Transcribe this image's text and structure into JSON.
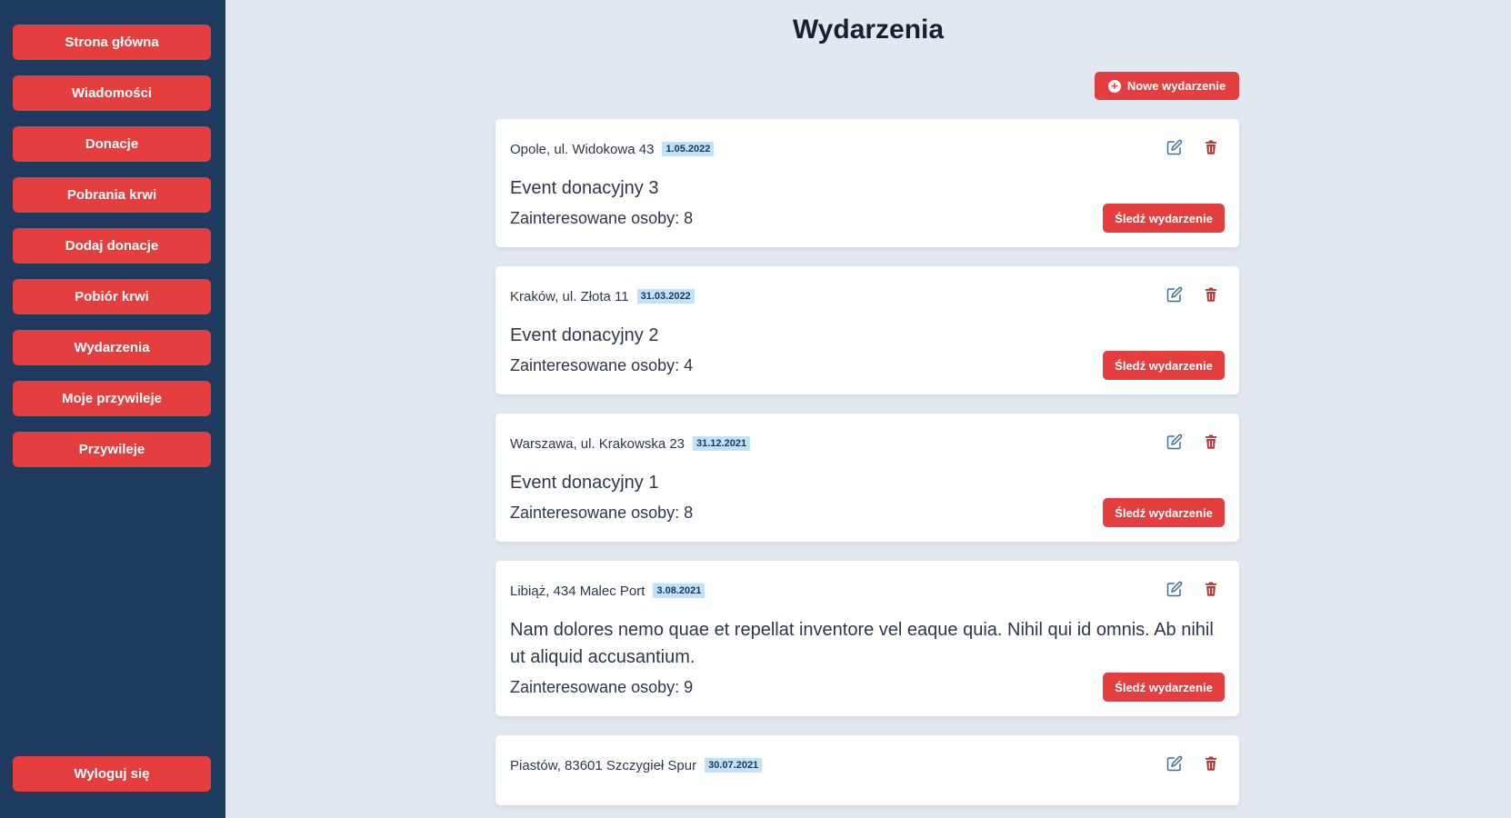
{
  "sidebar": {
    "items": [
      {
        "label": "Strona główna"
      },
      {
        "label": "Wiadomości"
      },
      {
        "label": "Donacje"
      },
      {
        "label": "Pobrania krwi"
      },
      {
        "label": "Dodaj donacje"
      },
      {
        "label": "Pobiór krwi"
      },
      {
        "label": "Wydarzenia"
      },
      {
        "label": "Moje przywileje"
      },
      {
        "label": "Przywileje"
      }
    ],
    "logout_label": "Wyloguj się"
  },
  "main": {
    "title": "Wydarzenia",
    "new_event_label": "Nowe wydarzenie",
    "interested_label": "Zainteresowane osoby:",
    "follow_label": "Śledź wydarzenie",
    "events": [
      {
        "location": "Opole, ul. Widokowa 43",
        "date": "1.05.2022",
        "name": "Event donacyjny 3",
        "interested": "Zainteresowane osoby: 8"
      },
      {
        "location": "Kraków, ul. Złota 11",
        "date": "31.03.2022",
        "name": "Event donacyjny 2",
        "interested": "Zainteresowane osoby: 4"
      },
      {
        "location": "Warszawa, ul. Krakowska 23",
        "date": "31.12.2021",
        "name": "Event donacyjny 1",
        "interested": "Zainteresowane osoby: 8"
      },
      {
        "location": "Libiąż, 434 Malec Port",
        "date": "3.08.2021",
        "name": "Nam dolores nemo quae et repellat inventore vel eaque quia. Nihil qui id omnis. Ab nihil ut aliquid accusantium.",
        "interested": "Zainteresowane osoby: 9"
      },
      {
        "location": "Piastów, 83601 Szczygieł Spur",
        "date": "30.07.2021",
        "name": "",
        "interested": ""
      }
    ]
  },
  "colors": {
    "sidebar_bg": "#1e3a5f",
    "accent_red": "#e53e3e",
    "page_bg": "#e2e8f0",
    "badge_bg": "#bee3f8",
    "edit_icon": "#3b6e99",
    "delete_icon": "#c53030"
  },
  "icons": {
    "new_event": "plus-circle-icon",
    "edit": "edit-icon",
    "delete": "trash-icon"
  }
}
